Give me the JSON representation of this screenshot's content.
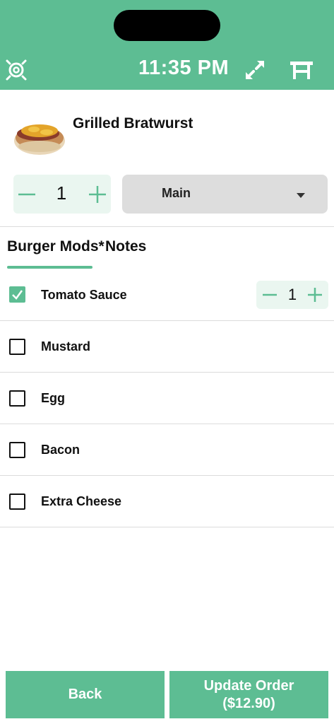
{
  "header": {
    "time": "11:35 PM",
    "bg_color": "#5dbd93",
    "icons": [
      "settings-icon",
      "expand-icon",
      "table-icon"
    ]
  },
  "item": {
    "name": "Grilled Bratwurst",
    "image_icon": "bratwurst-thumbnail",
    "quantity": "1",
    "course": "Main"
  },
  "tabs": [
    {
      "label": "Burger Mods*",
      "active": true
    },
    {
      "label": "Notes",
      "active": false
    }
  ],
  "modifiers": [
    {
      "label": "Tomato Sauce",
      "checked": true,
      "quantity": "1"
    },
    {
      "label": "Mustard",
      "checked": false
    },
    {
      "label": "Egg",
      "checked": false
    },
    {
      "label": "Bacon",
      "checked": false
    },
    {
      "label": "Extra Cheese",
      "checked": false
    }
  ],
  "footer": {
    "back_label": "Back",
    "update_label_line1": "Update Order",
    "update_label_line2": "($12.90)"
  },
  "colors": {
    "accent": "#5dbd93",
    "accent_light": "#eaf6f0",
    "select_bg": "#dddddd"
  }
}
